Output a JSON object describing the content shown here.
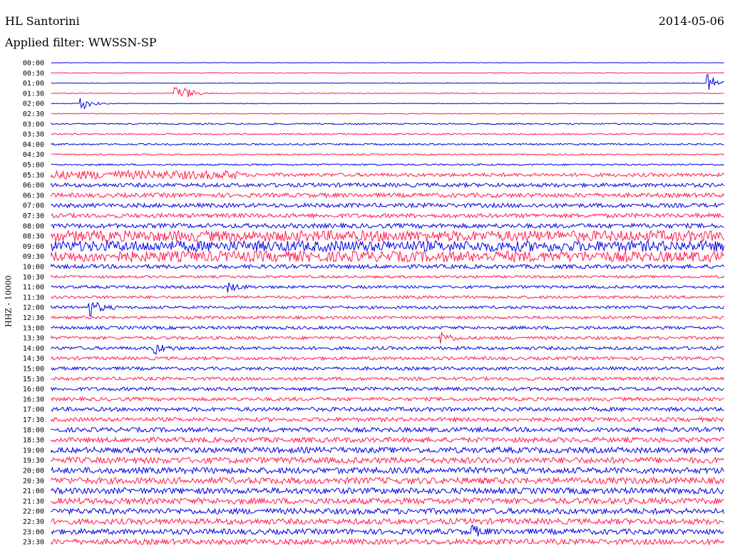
{
  "header": {
    "station": "HL Santorini",
    "date": "2014-05-06",
    "filter": "Applied filter: WWSSN-SP"
  },
  "chart_data": {
    "type": "helicorder",
    "ylabel": "HHZ - 10000",
    "row_labels": [
      "00:00",
      "00:30",
      "01:00",
      "01:30",
      "02:00",
      "02:30",
      "03:00",
      "03:30",
      "04:00",
      "04:30",
      "05:00",
      "05:30",
      "06:00",
      "06:30",
      "07:00",
      "07:30",
      "08:00",
      "08:30",
      "09:00",
      "09:30",
      "10:00",
      "10:30",
      "11:00",
      "11:30",
      "12:00",
      "12:30",
      "13:00",
      "13:30",
      "14:00",
      "14:30",
      "15:00",
      "15:30",
      "16:00",
      "16:30",
      "17:00",
      "17:30",
      "18:00",
      "18:30",
      "19:00",
      "19:30",
      "20:00",
      "20:30",
      "21:00",
      "21:30",
      "22:00",
      "22:30",
      "23:00",
      "23:30"
    ],
    "colors": [
      "#0000e6",
      "#ff1a4f"
    ],
    "noise_level": [
      0.3,
      0.5,
      0.4,
      0.6,
      0.5,
      0.6,
      1,
      1,
      1.2,
      1,
      1.2,
      2.5,
      2.8,
      3,
      3,
      3,
      3.2,
      3.2,
      3.5,
      3.5,
      2.8,
      1.8,
      2,
      2,
      2,
      2,
      2.2,
      2.2,
      2.3,
      2.3,
      2.3,
      2.3,
      2.5,
      2.5,
      2.8,
      2.8,
      3.2,
      3.5,
      4,
      4.2,
      4.2,
      4.5,
      4.2,
      4.2,
      4,
      4,
      3.8,
      3.8
    ]
  }
}
